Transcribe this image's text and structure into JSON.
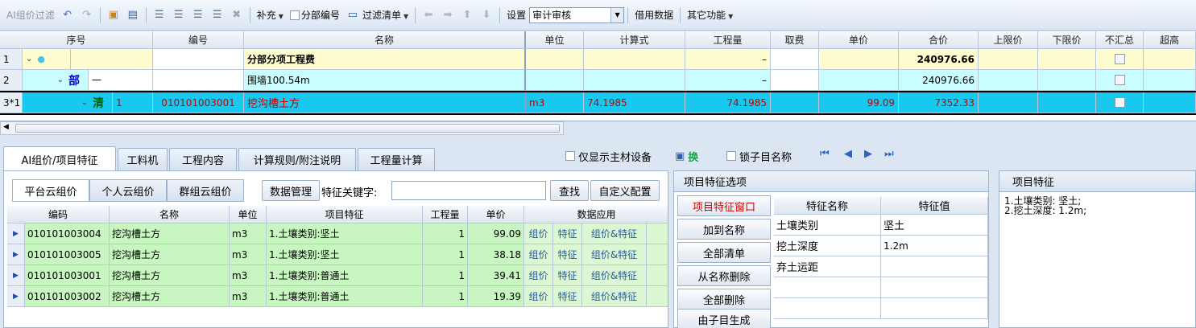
{
  "toolbar": {
    "ai_filter": "AI组价过滤",
    "supplement": "补充",
    "sub_code": "分部编号",
    "filter_list": "过滤清单",
    "settings": "设置",
    "audit_select": "审计审核",
    "borrow_data": "借用数据",
    "other_functions": "其它功能"
  },
  "grid": {
    "headers": [
      "序号",
      "编号",
      "名称",
      "单位",
      "计算式",
      "工程量",
      "取费",
      "单价",
      "合价",
      "上限价",
      "下限价",
      "不汇总",
      "超高"
    ],
    "rows": [
      {
        "num": "1",
        "code": "",
        "name": "分部分项工程费",
        "unit": "",
        "formula": "",
        "qty": "–",
        "unit_price": "",
        "total": "240976.66"
      },
      {
        "num": "2",
        "tag": "部",
        "seq": "一",
        "code": "",
        "name": "围墙100.54m",
        "unit": "",
        "formula": "",
        "qty": "–",
        "unit_price": "",
        "total": "240976.66"
      },
      {
        "num": "3*1",
        "tag": "清",
        "seq": "1",
        "code": "010101003001",
        "name": "挖沟槽土方",
        "unit": "m3",
        "formula": "74.1985",
        "qty": "74.1985",
        "unit_price": "99.09",
        "total": "7352.33"
      }
    ]
  },
  "tabs": [
    "AI组价/项目特征",
    "工料机",
    "工程内容",
    "计算规则/附注说明",
    "工程量计算"
  ],
  "options": {
    "main_material": "仅显示主材设备",
    "swap": "换",
    "lock_name": "锁子目名称"
  },
  "left_panel": {
    "subtabs": [
      "平台云组价",
      "个人云组价",
      "群组云组价"
    ],
    "data_manage": "数据管理",
    "keyword_label": "特征关键字:",
    "search": "查找",
    "custom_config": "自定义配置",
    "headers": [
      "编码",
      "名称",
      "单位",
      "项目特征",
      "工程量",
      "单价",
      "数据应用"
    ],
    "actions": [
      "组价",
      "特征",
      "组价&特征"
    ],
    "rows": [
      {
        "code": "010101003004",
        "name": "挖沟槽土方",
        "unit": "m3",
        "feature": "1.土壤类别:坚土",
        "qty": "1",
        "price": "99.09"
      },
      {
        "code": "010101003005",
        "name": "挖沟槽土方",
        "unit": "m3",
        "feature": "1.土壤类别:坚土",
        "qty": "1",
        "price": "38.18"
      },
      {
        "code": "010101003001",
        "name": "挖沟槽土方",
        "unit": "m3",
        "feature": "1.土壤类别:普通土",
        "qty": "1",
        "price": "39.41"
      },
      {
        "code": "010101003002",
        "name": "挖沟槽土方",
        "unit": "m3",
        "feature": "1.土壤类别:普通土",
        "qty": "1",
        "price": "19.39"
      }
    ]
  },
  "mid_panel": {
    "title": "项目特征选项",
    "buttons": [
      "项目特征窗口",
      "加到名称",
      "全部清单",
      "从名称删除",
      "全部删除",
      "由子目生成"
    ],
    "headers": [
      "特征名称",
      "特征值"
    ],
    "rows": [
      {
        "name": "土壤类别",
        "value": "坚土"
      },
      {
        "name": "挖土深度",
        "value": "1.2m"
      },
      {
        "name": "弃土运距",
        "value": ""
      }
    ]
  },
  "right_panel": {
    "title": "项目特征",
    "lines": [
      "1.土壤类别: 坚土;",
      "2.挖土深度: 1.2m;"
    ]
  }
}
